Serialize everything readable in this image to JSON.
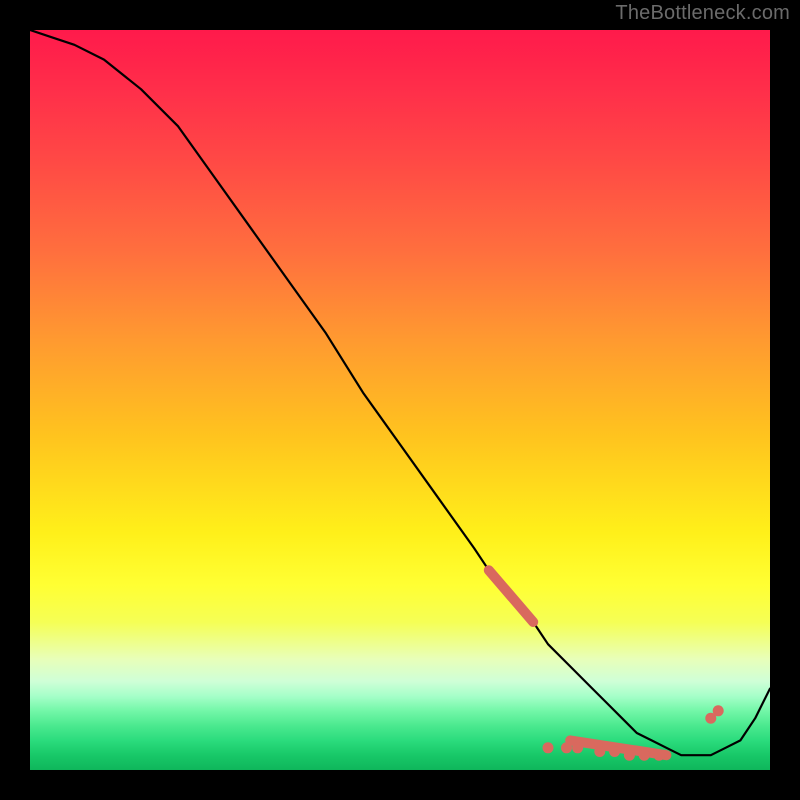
{
  "attribution": "TheBottleneck.com",
  "colors": {
    "background": "#000000",
    "curve": "#000000",
    "markers": "#d9695e"
  },
  "chart_data": {
    "type": "line",
    "title": "",
    "xlabel": "",
    "ylabel": "",
    "xlim": [
      0,
      100
    ],
    "ylim": [
      0,
      100
    ],
    "x": [
      0,
      3,
      6,
      10,
      15,
      20,
      25,
      30,
      35,
      40,
      45,
      50,
      55,
      60,
      62,
      65,
      68,
      70,
      73,
      76,
      78,
      80,
      82,
      84,
      86,
      88,
      90,
      92,
      94,
      96,
      98,
      100
    ],
    "values": [
      100,
      99,
      98,
      96,
      92,
      87,
      80,
      73,
      66,
      59,
      51,
      44,
      37,
      30,
      27,
      23,
      20,
      17,
      14,
      11,
      9,
      7,
      5,
      4,
      3,
      2,
      2,
      2,
      3,
      4,
      7,
      11
    ],
    "series": [
      {
        "name": "curve",
        "x": [
          0,
          3,
          6,
          10,
          15,
          20,
          25,
          30,
          35,
          40,
          45,
          50,
          55,
          60,
          62,
          65,
          68,
          70,
          73,
          76,
          78,
          80,
          82,
          84,
          86,
          88,
          90,
          92,
          94,
          96,
          98,
          100
        ],
        "values": [
          100,
          99,
          98,
          96,
          92,
          87,
          80,
          73,
          66,
          59,
          51,
          44,
          37,
          30,
          27,
          23,
          20,
          17,
          14,
          11,
          9,
          7,
          5,
          4,
          3,
          2,
          2,
          2,
          3,
          4,
          7,
          11
        ]
      }
    ],
    "markers": {
      "segments": [
        {
          "x0": 62,
          "y0": 27,
          "x1": 68,
          "y1": 20
        },
        {
          "x0": 73,
          "y0": 4,
          "x1": 86,
          "y1": 2
        }
      ],
      "points": [
        {
          "x": 70,
          "y": 3
        },
        {
          "x": 72.5,
          "y": 3
        },
        {
          "x": 74,
          "y": 3
        },
        {
          "x": 77,
          "y": 2.5
        },
        {
          "x": 79,
          "y": 2.5
        },
        {
          "x": 81,
          "y": 2
        },
        {
          "x": 83,
          "y": 2
        },
        {
          "x": 85,
          "y": 2
        },
        {
          "x": 92,
          "y": 7
        },
        {
          "x": 93,
          "y": 8
        }
      ]
    },
    "gradient_stops": [
      {
        "pct": 0,
        "color": "#ff1a4b"
      },
      {
        "pct": 50,
        "color": "#ffd21e"
      },
      {
        "pct": 78,
        "color": "#ffff33"
      },
      {
        "pct": 100,
        "color": "#0fb65b"
      }
    ]
  }
}
